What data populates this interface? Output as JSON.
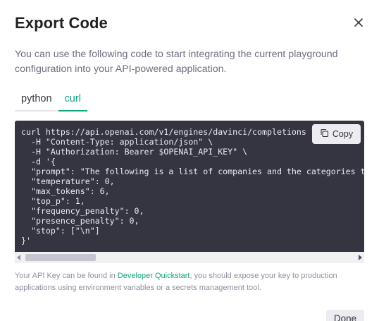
{
  "modal": {
    "title": "Export Code",
    "close_icon": "close-icon",
    "description": "You can use the following code to start integrating the current playground configuration into your API-powered application."
  },
  "tabs": [
    {
      "label": "python",
      "active": false
    },
    {
      "label": "curl",
      "active": true
    }
  ],
  "code": {
    "lines": [
      "curl https://api.openai.com/v1/engines/davinci/completions \\",
      "  -H \"Content-Type: application/json\" \\",
      "  -H \"Authorization: Bearer $OPENAI_API_KEY\" \\",
      "  -d '{",
      "  \"prompt\": \"The following is a list of companies and the categories they fall into",
      "  \"temperature\": 0,",
      "  \"max_tokens\": 6,",
      "  \"top_p\": 1,",
      "  \"frequency_penalty\": 0,",
      "  \"presence_penalty\": 0,",
      "  \"stop\": [\"\\n\"]",
      "}'"
    ],
    "copy_label": "Copy",
    "copy_icon": "copy-icon",
    "scroll_position": 0
  },
  "footnote": {
    "before_link": "Your API Key can be found in ",
    "link_text": "Developer Quickstart",
    "after_link": ", you should expose your key to production applications using environment variables or a secrets management tool."
  },
  "done_label": "Done",
  "colors": {
    "accent": "#10a37f",
    "code_bg": "#343541",
    "code_text": "#ececf1",
    "muted_text": "#6e6e80"
  }
}
